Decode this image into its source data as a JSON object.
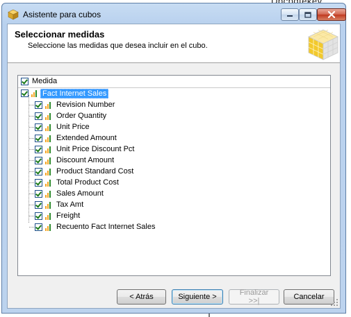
{
  "background": {
    "peek_text": "Dbcbdtekev"
  },
  "window": {
    "title": "Asistente para cubos",
    "controls": {
      "minimize_icon": "minimize-icon",
      "maximize_icon": "maximize-icon",
      "close_icon": "close-icon"
    }
  },
  "header": {
    "title": "Seleccionar medidas",
    "subtitle": "Seleccione las medidas que desea incluir en el cubo."
  },
  "tree": {
    "column_header": "Medida",
    "root": {
      "label": "Fact Internet Sales",
      "checked": true,
      "selected": true
    },
    "items": [
      {
        "label": "Revision Number",
        "checked": true
      },
      {
        "label": "Order Quantity",
        "checked": true
      },
      {
        "label": "Unit Price",
        "checked": true
      },
      {
        "label": "Extended Amount",
        "checked": true
      },
      {
        "label": "Unit Price Discount Pct",
        "checked": true
      },
      {
        "label": "Discount Amount",
        "checked": true
      },
      {
        "label": "Product Standard Cost",
        "checked": true
      },
      {
        "label": "Total Product Cost",
        "checked": true
      },
      {
        "label": "Sales Amount",
        "checked": true
      },
      {
        "label": "Tax Amt",
        "checked": true
      },
      {
        "label": "Freight",
        "checked": true
      },
      {
        "label": "Recuento Fact Internet Sales",
        "checked": true
      }
    ]
  },
  "buttons": {
    "back": "< Atrás",
    "next": "Siguiente >",
    "finish": "Finalizar >>|",
    "cancel": "Cancelar"
  },
  "colors": {
    "selection": "#3399ff",
    "measure_icon_bars": [
      "#f5a623",
      "#2e8b2e"
    ]
  }
}
